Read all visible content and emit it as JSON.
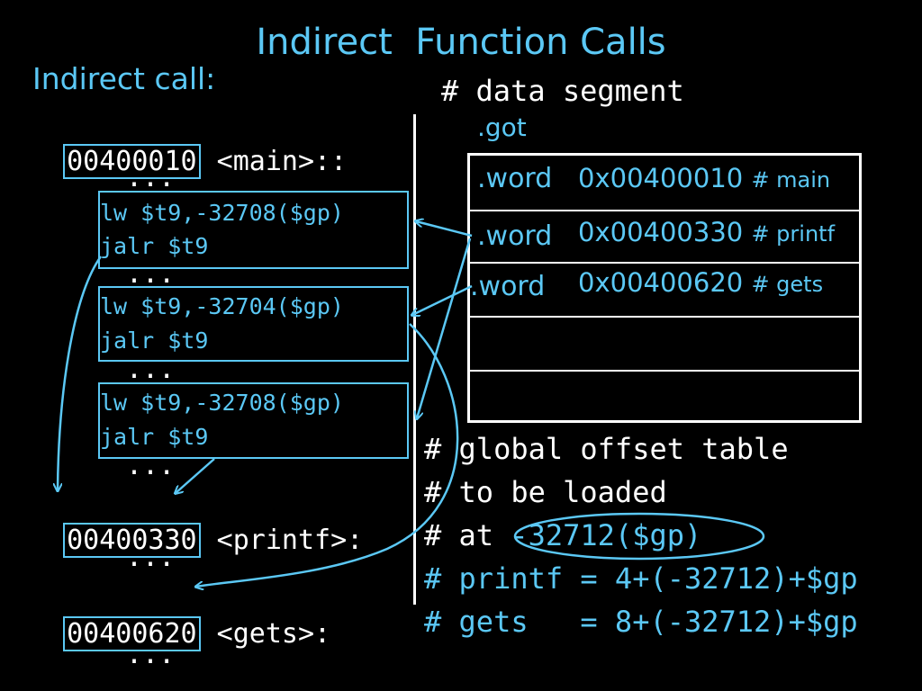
{
  "title": "Indirect  Function Calls",
  "subtitle": "Indirect call:",
  "code": {
    "main_addr": "00400010",
    "main_label": " <main>:",
    "dots": "...",
    "blocks": [
      {
        "lw": "lw $t9,-32708($gp)",
        "jalr": "jalr $t9"
      },
      {
        "lw": "lw $t9,-32704($gp)",
        "jalr": "jalr $t9"
      },
      {
        "lw": "lw $t9,-32708($gp)",
        "jalr": "jalr $t9"
      }
    ],
    "printf_addr": "00400330",
    "printf_label": " <printf>:",
    "gets_addr": "00400620",
    "gets_label": " <gets>:"
  },
  "data_segment": {
    "header": "# data segment",
    "got_label": ".got",
    "rows": [
      {
        "word": ".word",
        "value": "0x00400010",
        "comment": "# main"
      },
      {
        "word": ".word",
        "value": "0x00400330",
        "comment": "# printf"
      },
      {
        "word": ".word",
        "value": "0x00400620",
        "comment": "# gets"
      }
    ]
  },
  "notes": {
    "line1": "# global offset table",
    "line2": "# to be loaded",
    "line3_prefix": "# at ",
    "line3_circled": "-32712($gp)",
    "line4": "# printf = 4+(-32712)+$gp",
    "line5": "# gets   = 8+(-32712)+$gp"
  },
  "colors": {
    "accent": "#5bc8f5",
    "text": "#ffffff",
    "background": "#000000"
  }
}
